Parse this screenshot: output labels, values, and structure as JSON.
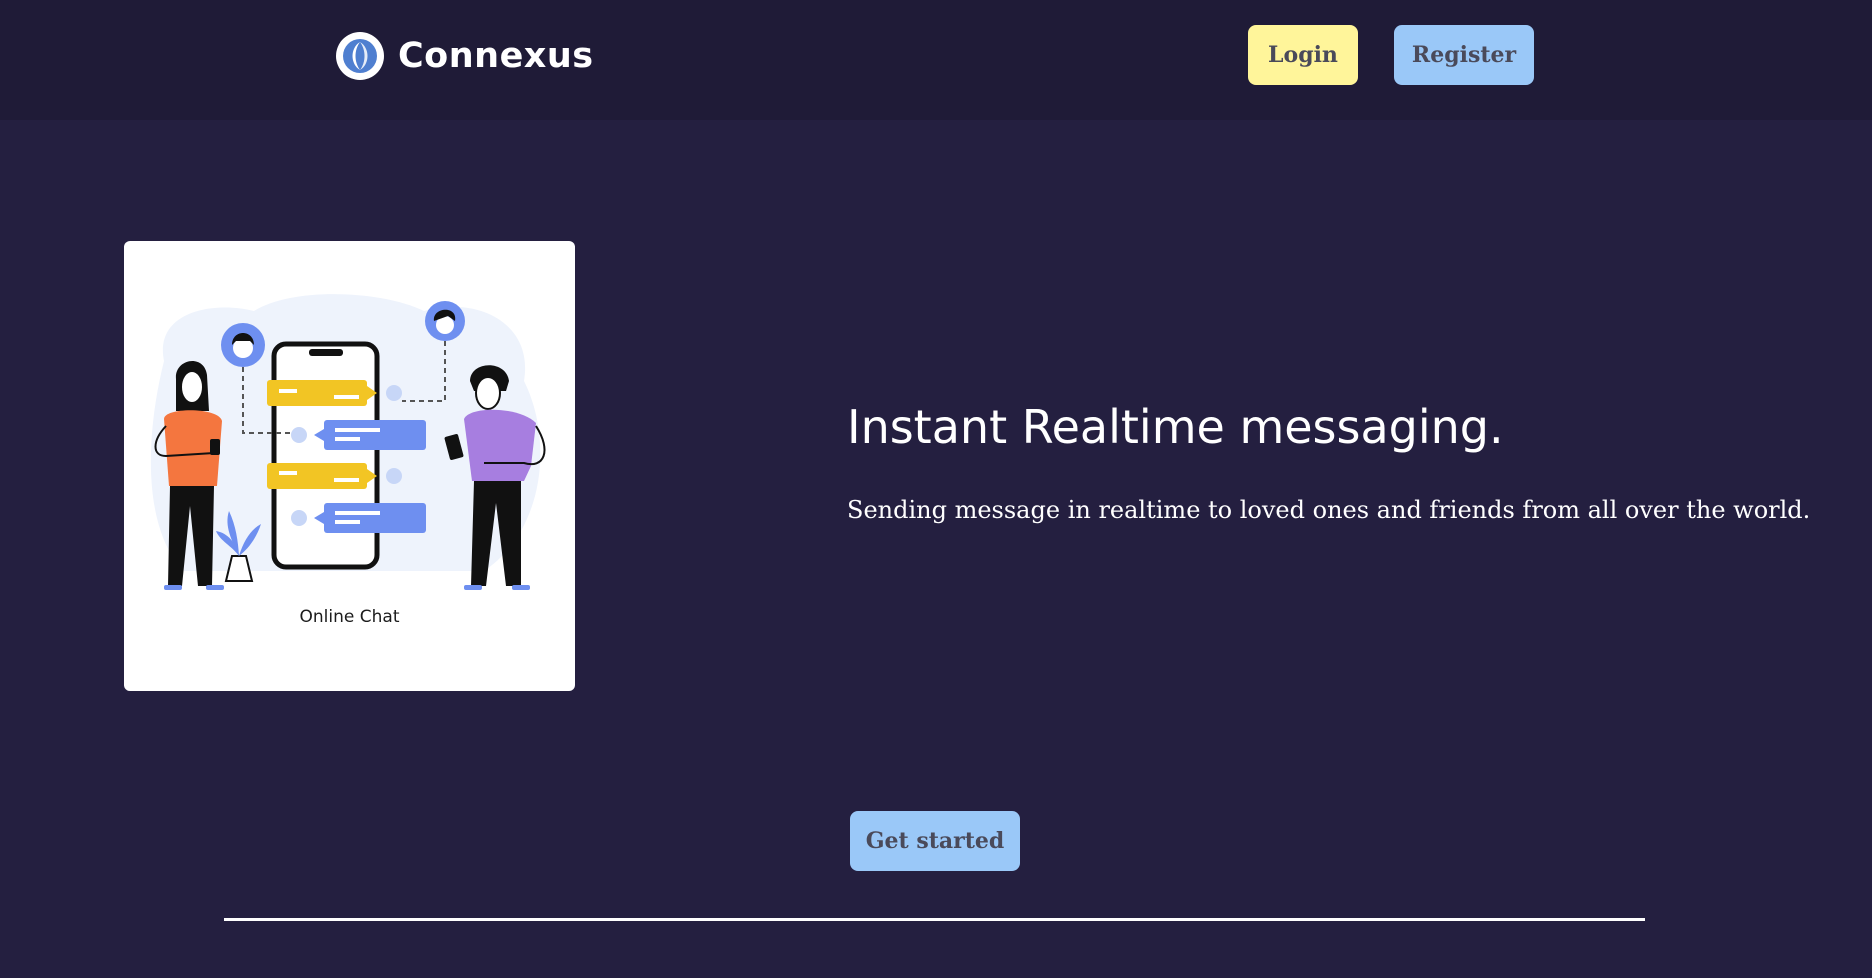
{
  "navbar": {
    "brand_name": "Connexus",
    "login_label": "Login",
    "register_label": "Register"
  },
  "hero": {
    "illustration_caption": "Online Chat",
    "headline": "Instant Realtime messaging.",
    "subtext": "Sending message in realtime to loved ones and friends from all over the world.",
    "cta_label": "Get started"
  },
  "colors": {
    "page_background": "#241f40",
    "navbar_background": "#1f1b37",
    "login_button": "#fff59a",
    "register_button": "#9ac8f8",
    "cta_button": "#9ac8f8"
  },
  "icons": {
    "brand_logo": "swirl-logo-icon"
  }
}
